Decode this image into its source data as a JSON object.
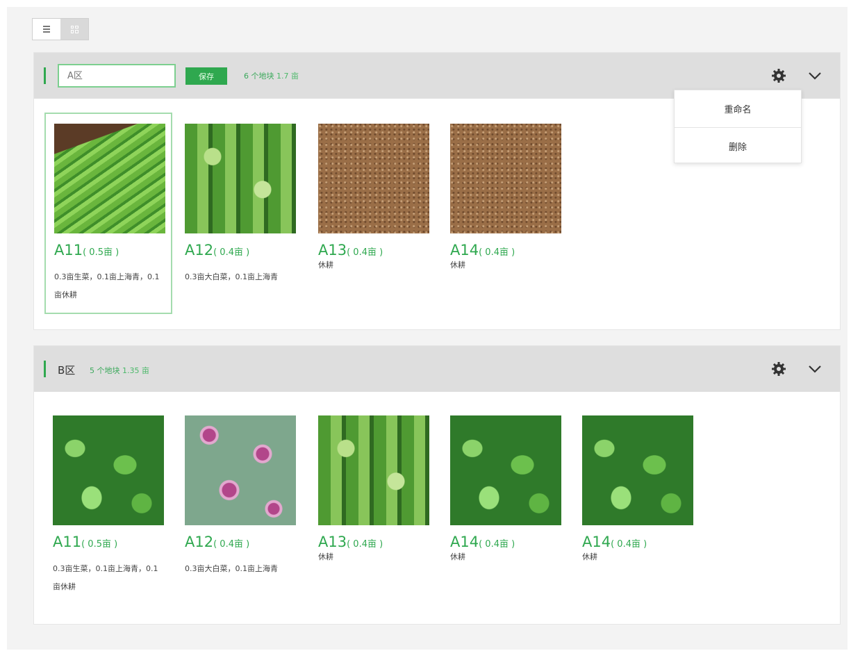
{
  "view_toggle": {
    "list_icon": "list-view-icon",
    "grid_icon": "grid-view-icon",
    "active": "grid"
  },
  "zone_a": {
    "name_placeholder": "A区",
    "save_label": "保存",
    "stats_count": "6 个地块",
    "stats_area": "1.7 亩",
    "menu": [
      "重命名",
      "删除"
    ],
    "plots": [
      {
        "code": "A11",
        "size": "( 0.5亩 )",
        "desc": "0.3亩生菜，0.1亩上海青，0.1亩休耕",
        "selected": true
      },
      {
        "code": "A12",
        "size": "( 0.4亩 )",
        "desc": "0.3亩大白菜，0.1亩上海青"
      },
      {
        "code": "A13",
        "size": "( 0.4亩 )",
        "desc": "休耕"
      },
      {
        "code": "A14",
        "size": "( 0.4亩 )",
        "desc": "休耕"
      }
    ]
  },
  "zone_b": {
    "title": "B区",
    "stats_count": "5 个地块",
    "stats_area": "1.35 亩",
    "plots": [
      {
        "code": "A11",
        "size": "( 0.5亩 )",
        "desc": "0.3亩生菜，0.1亩上海青，0.1亩休耕"
      },
      {
        "code": "A12",
        "size": "( 0.4亩 )",
        "desc": "0.3亩大白菜，0.1亩上海青"
      },
      {
        "code": "A13",
        "size": "( 0.4亩 )",
        "desc": "休耕"
      },
      {
        "code": "A14",
        "size": "( 0.4亩 )",
        "desc": "休耕"
      },
      {
        "code": "A14",
        "size": "( 0.4亩 )",
        "desc": "休耕"
      }
    ]
  },
  "colors": {
    "accent": "#2fa84f",
    "header_bg": "#dedede",
    "page_bg": "#f3f3f3"
  }
}
